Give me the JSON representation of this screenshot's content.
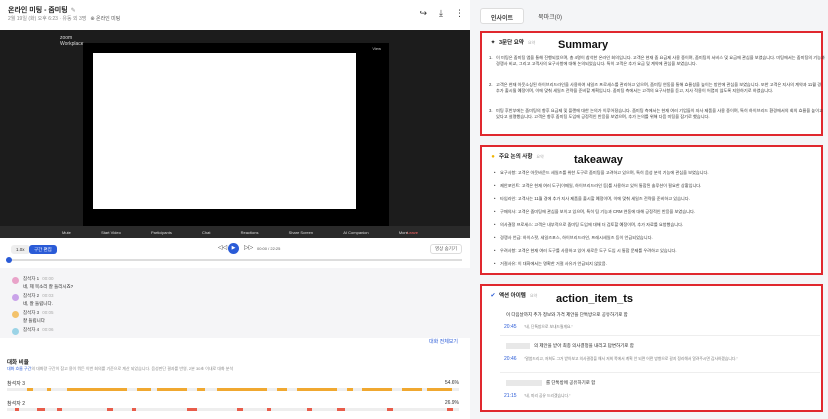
{
  "header": {
    "title": "온라인 미팅 - 줌미팅",
    "meta": "2월 19일 (화) 오후 6:23 · 유동 외 3명",
    "tag": "온라인 미팅"
  },
  "video": {
    "logo_top": "zoom",
    "logo_bottom": "Workplace",
    "screen_label": "View",
    "toolbar": [
      "Mute",
      "Start Video",
      "Participants",
      "Chat",
      "Reactions",
      "Share Screen",
      "AI Companion",
      "More"
    ],
    "leave": "Leave"
  },
  "controls": {
    "speed_tab": "1.0x",
    "active_tab": "구간 편집",
    "time": "00:00 / 22:25",
    "hide_btn": "영상 숨기기",
    "progress": 0
  },
  "transcript": {
    "speakers": [
      {
        "name": "참석자 1",
        "time": "00:00",
        "text": "네, 제 목소리 잘 들리시죠?",
        "color": "#e9a3c9"
      },
      {
        "name": "참석자 2",
        "time": "00:03",
        "text": "네, 잘 들립니다.",
        "color": "#c9a3e9"
      },
      {
        "name": "참석자 3",
        "time": "00:05",
        "text": "잘 들립니다",
        "color": "#f3c26b"
      },
      {
        "name": "참석자 4",
        "time": "00:06",
        "text": "",
        "color": "#9bd3e6"
      }
    ],
    "more_link": "대화 전체보기"
  },
  "ratio": {
    "heading": "대화 비율",
    "desc": "대화 흐름 구간",
    "desc_rest": "의 대화량 구간이 참고 용이 뭐든 이번 회의를 기준으로 계산 되었습니다. 음성판단 결과를 반영, 2분 30초 이내로 대화 분석",
    "bars": [
      {
        "label": "참석자 3",
        "pct": "54.6%",
        "color": "#f0a830"
      },
      {
        "label": "참석자 2",
        "pct": "26.9%",
        "color": "#e85c4a"
      }
    ]
  },
  "panel": {
    "tabs": [
      "인사이트",
      "북마크(0)"
    ],
    "summary": {
      "title": "3문단 요약",
      "sub": "요약",
      "label": "Summary",
      "paras": [
        "이 미팅은 줌미팅 앱을 통해 진행되었으며, 총 4명이 참석한 온라인 회의입니다. 고객은 현재 줌 요금제 사용 중이며, 줌미팅의 서비스 및 요금에 관심을 보였습니다. 미팅에서는 줌미팅의 기능과 경쟁사 비교, 그리고 고객사의 요구사항에 대해 논의되었습니다. 특히 고객은 추가 요금 및 계약에 관심을 보였습니다.",
        "고객은 현재 아웃소싱된 하이브리드라인을 사용하여 세일즈 프로세스를 관리하고 있으며, 줌미팅 연동을 통해 효율성을 높이는 방안에 관심을 보였습니다. 또한 고객은 지사의 계약과 11월 경 추가 출시될 예정이며, 이에 맞춰 세일즈 전략을 준비할 계획입니다. 줌미팅 측에서는 고객의 요구사항을 듣고, 지사 적용이 어렵지 않도록 지원하기로 하였습니다.",
        "미팅 후반부에는 줌미팅의 향후 요금제 및 플랜에 대한 논의가 이루어졌습니다. 줌미팅 측에서는 현재 여러 기업들이 자사 제품을 사용 중이며, 특히 하이브리드 환경에서의 회의 효율을 높이고 있다고 설명했습니다. 고객은 향후 줌미팅 도입에 긍정적인 반응을 보였으며, 추가 논의를 위해 다음 미팅을 잡기로 했습니다."
      ]
    },
    "takeaway": {
      "title": "주요 논의 사항",
      "sub": "요약",
      "label": "takeaway",
      "items": [
        "요구사항: 고객은 아웃바운드 세일즈를 위한 도구로 줌미팅을 고려하고 있으며, 특히 음성 분석 기능에 관심을 보였습니다.",
        "제안포인트: 고객은 현재 여러 도구(이메일, 하이브리드라인 등)를 사용하고 있어 통합된 솔루션이 필요한 상황입니다.",
        "타임라인: 고객사는 11월 경에 추가 지사 제품을 출시할 예정이며, 이에 맞춰 세일즈 전략을 준비하고 있습니다.",
        "구매의사: 고객은 줌미팅에 관심을 보이고 있으며, 특히 팀 기능과 CRM 연동에 대해 긍정적인 반응을 보였습니다.",
        "의사결정 프로세스: 고객은 내부적으로 줌미팅 도입에 대해 더 검토할 예정이며, 추가 자료를 요청했습니다.",
        "경쟁사 언급: 하이스팟, 세일즈포스, 하이브리드라인, 프레시세일즈 등이 언급되었습니다.",
        "우려사항: 고객은 현재 여러 도구를 사용하고 있어 새로운 도구 도입 시 통합 문제를 우려하고 있습니다.",
        "거절사유: 이 대화에서는 명확한 거절 사유가 언급되지 않았음."
      ]
    },
    "actions": {
      "title": "액션 아이템",
      "sub": "요약",
      "label": "action_item_ts",
      "items": [
        {
          "text": "이 다음날까지 추가 정보와 가격 제안을 단톡방으로 공유하기로 함",
          "time": "20:45",
          "note": "\"네, 단톡방으로 보내드릴게요.\""
        },
        {
          "text": "의 제안을 받아 최종 의사결정을 내리고 답변하기로 함",
          "time": "20:46",
          "note": "\"말씀드리고, 저희도 그거 받아보고 의사결정을 해서 저희 쪽에서 계획 안 되면 어떤 방향으로 갈지 정리해서 알려주시면 감사하겠습니다.\""
        },
        {
          "text": "를 단톡방에 공유하기로 함",
          "time": "21:15",
          "note": "\"네, 미리 공유 드리겠습니다.\""
        }
      ]
    }
  }
}
